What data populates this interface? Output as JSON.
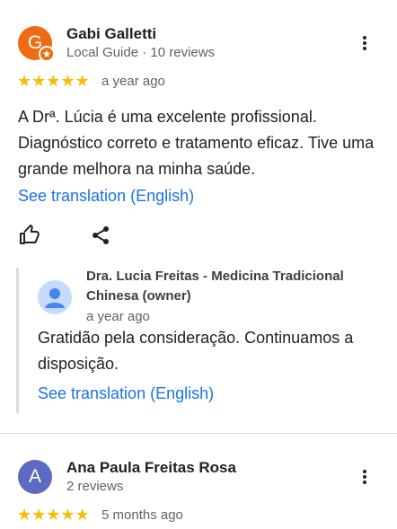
{
  "review1": {
    "avatar_letter": "G",
    "avatar_color": "#f06a14",
    "name": "Gabi Galletti",
    "meta": "Local Guide · 10 reviews",
    "stars": "★★★★★",
    "rating": 5,
    "time": "a year ago",
    "text": "A Drª. Lúcia é uma excelente profissional. Diagnóstico correto e tratamento eficaz. Tive uma grande melhora na minha saúde.",
    "translate": "See translation (English)",
    "more_icon": "more-vert-icon",
    "like_icon": "thumb-up-icon",
    "share_icon": "share-icon"
  },
  "owner_reply": {
    "name": "Dra. Lucia Freitas - Medicina Tradicional Chinesa (owner)",
    "time": "a year ago",
    "text": "Gratidão pela consideração. Continuamos a disposição.",
    "translate": "See translation (English)",
    "avatar_icon": "person-avatar-icon"
  },
  "review2": {
    "avatar_letter": "A",
    "avatar_color": "#5c6bc0",
    "name": "Ana Paula Freitas Rosa",
    "meta": "2 reviews",
    "stars": "★★★★★",
    "rating": 5,
    "time": "5 months ago",
    "more_icon": "more-vert-icon"
  }
}
